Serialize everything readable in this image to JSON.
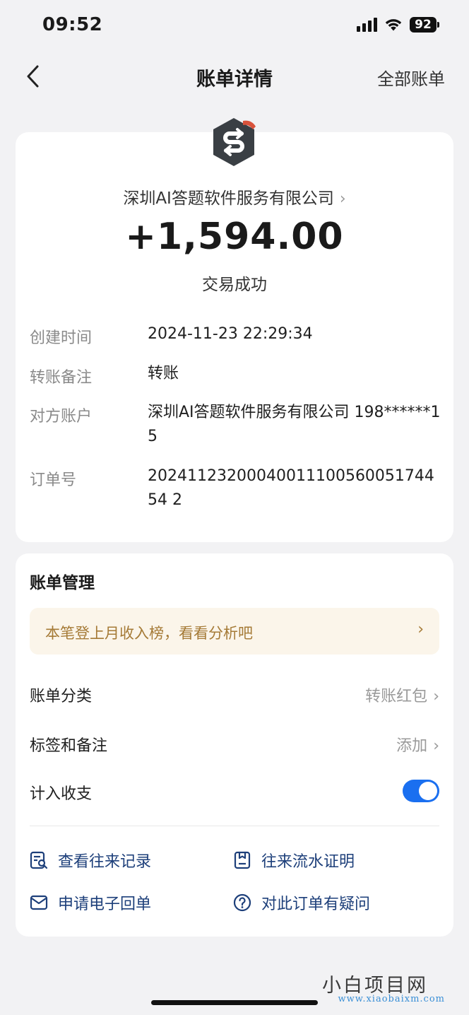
{
  "status_bar": {
    "time": "09:52",
    "battery": "92"
  },
  "nav": {
    "title": "账单详情",
    "action": "全部账单",
    "back_icon": "chevron-left-icon"
  },
  "transaction": {
    "merchant": "深圳AI答题软件服务有限公司",
    "amount": "+1,594.00",
    "status": "交易成功",
    "logo_icon": "transfer-s-icon"
  },
  "details": [
    {
      "label": "创建时间",
      "value": "2024-11-23 22:29:34"
    },
    {
      "label": "转账备注",
      "value": "转账"
    },
    {
      "label": "对方账户",
      "value": "深圳AI答题软件服务有限公司 198******15"
    },
    {
      "label": "订单号",
      "value": "2024112320004001110056005174454 2"
    }
  ],
  "manage": {
    "title": "账单管理",
    "promo": "本笔登上月收入榜，看看分析吧",
    "category_label": "账单分类",
    "category_value": "转账红包",
    "tags_label": "标签和备注",
    "tags_value": "添加",
    "include_label": "计入收支",
    "include_enabled": true,
    "links": [
      {
        "label": "查看往来记录",
        "icon": "records-search-icon"
      },
      {
        "label": "往来流水证明",
        "icon": "statement-doc-icon"
      },
      {
        "label": "申请电子回单",
        "icon": "mail-icon"
      },
      {
        "label": "对此订单有疑问",
        "icon": "question-circle-icon"
      }
    ]
  },
  "watermark": {
    "name": "小白项目网",
    "url": "www.xiaobaixm.com"
  },
  "colors": {
    "accent": "#1a6ff0",
    "link": "#1d3f7a",
    "promo_bg": "#fbf5ea",
    "promo_text": "#a57a36",
    "logo": "#3a3f44"
  }
}
